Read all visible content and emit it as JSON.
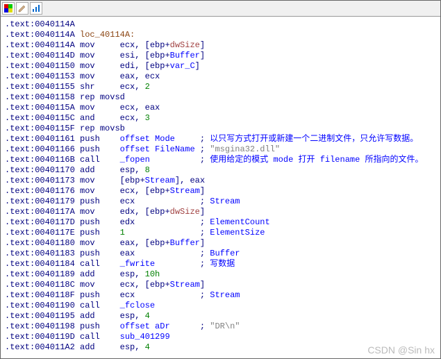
{
  "toolbar": {
    "btn1": "color-swatch-icon",
    "btn2": "pencil-icon",
    "btn3": "chart-icon"
  },
  "watermark": "CSDN @Sin hx",
  "lines": [
    {
      "addr": ".text:0040114A",
      "rest": []
    },
    {
      "addr": ".text:0040114A ",
      "rest": [
        {
          "c": "brown",
          "t": "loc_40114A:"
        }
      ]
    },
    {
      "addr": ".text:0040114A ",
      "rest": [
        {
          "c": "navy",
          "t": "mov     ecx, [ebp+"
        },
        {
          "c": "red",
          "t": "dwSize"
        },
        {
          "c": "navy",
          "t": "]"
        }
      ]
    },
    {
      "addr": ".text:0040114D ",
      "rest": [
        {
          "c": "navy",
          "t": "mov     esi, [ebp+"
        },
        {
          "c": "blue",
          "t": "Buffer"
        },
        {
          "c": "navy",
          "t": "]"
        }
      ]
    },
    {
      "addr": ".text:00401150 ",
      "rest": [
        {
          "c": "navy",
          "t": "mov     edi, [ebp+"
        },
        {
          "c": "blue",
          "t": "var_C"
        },
        {
          "c": "navy",
          "t": "]"
        }
      ]
    },
    {
      "addr": ".text:00401153 ",
      "rest": [
        {
          "c": "navy",
          "t": "mov     eax, ecx"
        }
      ]
    },
    {
      "addr": ".text:00401155 ",
      "rest": [
        {
          "c": "navy",
          "t": "shr     ecx, "
        },
        {
          "c": "green",
          "t": "2"
        }
      ]
    },
    {
      "addr": ".text:00401158 ",
      "rest": [
        {
          "c": "navy",
          "t": "rep movsd"
        }
      ]
    },
    {
      "addr": ".text:0040115A ",
      "rest": [
        {
          "c": "navy",
          "t": "mov     ecx, eax"
        }
      ]
    },
    {
      "addr": ".text:0040115C ",
      "rest": [
        {
          "c": "navy",
          "t": "and     ecx, "
        },
        {
          "c": "green",
          "t": "3"
        }
      ]
    },
    {
      "addr": ".text:0040115F ",
      "rest": [
        {
          "c": "navy",
          "t": "rep movsb"
        }
      ]
    },
    {
      "addr": ".text:00401161 ",
      "rest": [
        {
          "c": "navy",
          "t": "push    "
        },
        {
          "c": "blue",
          "t": "offset Mode"
        },
        {
          "c": "navy",
          "t": "     ; "
        },
        {
          "c": "blue",
          "t": "以只写方式打开或新建一个二进制文件，只允许写数据。"
        }
      ]
    },
    {
      "addr": ".text:00401166 ",
      "rest": [
        {
          "c": "navy",
          "t": "push    "
        },
        {
          "c": "blue",
          "t": "offset FileName"
        },
        {
          "c": "navy",
          "t": " ; "
        },
        {
          "c": "gray",
          "t": "\"msgina32.dll\""
        }
      ]
    },
    {
      "addr": ".text:0040116B ",
      "rest": [
        {
          "c": "navy",
          "t": "call    "
        },
        {
          "c": "blue",
          "t": "_fopen"
        },
        {
          "c": "navy",
          "t": "          ; "
        },
        {
          "c": "blue",
          "t": "使用给定的模式 mode 打开 filename 所指向的文件。"
        }
      ]
    },
    {
      "addr": ".text:00401170 ",
      "rest": [
        {
          "c": "navy",
          "t": "add     esp, "
        },
        {
          "c": "green",
          "t": "8"
        }
      ]
    },
    {
      "addr": ".text:00401173 ",
      "rest": [
        {
          "c": "navy",
          "t": "mov     [ebp+"
        },
        {
          "c": "blue",
          "t": "Stream"
        },
        {
          "c": "navy",
          "t": "], eax"
        }
      ]
    },
    {
      "addr": ".text:00401176 ",
      "rest": [
        {
          "c": "navy",
          "t": "mov     ecx, [ebp+"
        },
        {
          "c": "blue",
          "t": "Stream"
        },
        {
          "c": "navy",
          "t": "]"
        }
      ]
    },
    {
      "addr": ".text:00401179 ",
      "rest": [
        {
          "c": "navy",
          "t": "push    ecx             ; "
        },
        {
          "c": "blue",
          "t": "Stream"
        }
      ]
    },
    {
      "addr": ".text:0040117A ",
      "rest": [
        {
          "c": "navy",
          "t": "mov     edx, [ebp+"
        },
        {
          "c": "red",
          "t": "dwSize"
        },
        {
          "c": "navy",
          "t": "]"
        }
      ]
    },
    {
      "addr": ".text:0040117D ",
      "rest": [
        {
          "c": "navy",
          "t": "push    edx             ; "
        },
        {
          "c": "blue",
          "t": "ElementCount"
        }
      ]
    },
    {
      "addr": ".text:0040117E ",
      "rest": [
        {
          "c": "navy",
          "t": "push    "
        },
        {
          "c": "green",
          "t": "1"
        },
        {
          "c": "navy",
          "t": "               ; "
        },
        {
          "c": "blue",
          "t": "ElementSize"
        }
      ]
    },
    {
      "addr": ".text:00401180 ",
      "rest": [
        {
          "c": "navy",
          "t": "mov     eax, [ebp+"
        },
        {
          "c": "blue",
          "t": "Buffer"
        },
        {
          "c": "navy",
          "t": "]"
        }
      ]
    },
    {
      "addr": ".text:00401183 ",
      "rest": [
        {
          "c": "navy",
          "t": "push    eax             ; "
        },
        {
          "c": "blue",
          "t": "Buffer"
        }
      ]
    },
    {
      "addr": ".text:00401184 ",
      "rest": [
        {
          "c": "navy",
          "t": "call    "
        },
        {
          "c": "blue",
          "t": "_fwrite"
        },
        {
          "c": "navy",
          "t": "         ; "
        },
        {
          "c": "blue",
          "t": "写数据"
        }
      ]
    },
    {
      "addr": ".text:00401189 ",
      "rest": [
        {
          "c": "navy",
          "t": "add     esp, "
        },
        {
          "c": "green",
          "t": "10h"
        }
      ]
    },
    {
      "addr": ".text:0040118C ",
      "rest": [
        {
          "c": "navy",
          "t": "mov     ecx, [ebp+"
        },
        {
          "c": "blue",
          "t": "Stream"
        },
        {
          "c": "navy",
          "t": "]"
        }
      ]
    },
    {
      "addr": ".text:0040118F ",
      "rest": [
        {
          "c": "navy",
          "t": "push    ecx             ; "
        },
        {
          "c": "blue",
          "t": "Stream"
        }
      ]
    },
    {
      "addr": ".text:00401190 ",
      "rest": [
        {
          "c": "navy",
          "t": "call    "
        },
        {
          "c": "blue",
          "t": "_fclose"
        }
      ]
    },
    {
      "addr": ".text:00401195 ",
      "rest": [
        {
          "c": "navy",
          "t": "add     esp, "
        },
        {
          "c": "green",
          "t": "4"
        }
      ]
    },
    {
      "addr": ".text:00401198 ",
      "rest": [
        {
          "c": "navy",
          "t": "push    "
        },
        {
          "c": "blue",
          "t": "offset aDr"
        },
        {
          "c": "navy",
          "t": "      ; "
        },
        {
          "c": "gray",
          "t": "\"DR\\n\""
        }
      ]
    },
    {
      "addr": ".text:0040119D ",
      "rest": [
        {
          "c": "navy",
          "t": "call    "
        },
        {
          "c": "blue",
          "t": "sub_401299"
        }
      ]
    },
    {
      "addr": ".text:004011A2 ",
      "rest": [
        {
          "c": "navy",
          "t": "add     esp, "
        },
        {
          "c": "green",
          "t": "4"
        }
      ]
    }
  ]
}
